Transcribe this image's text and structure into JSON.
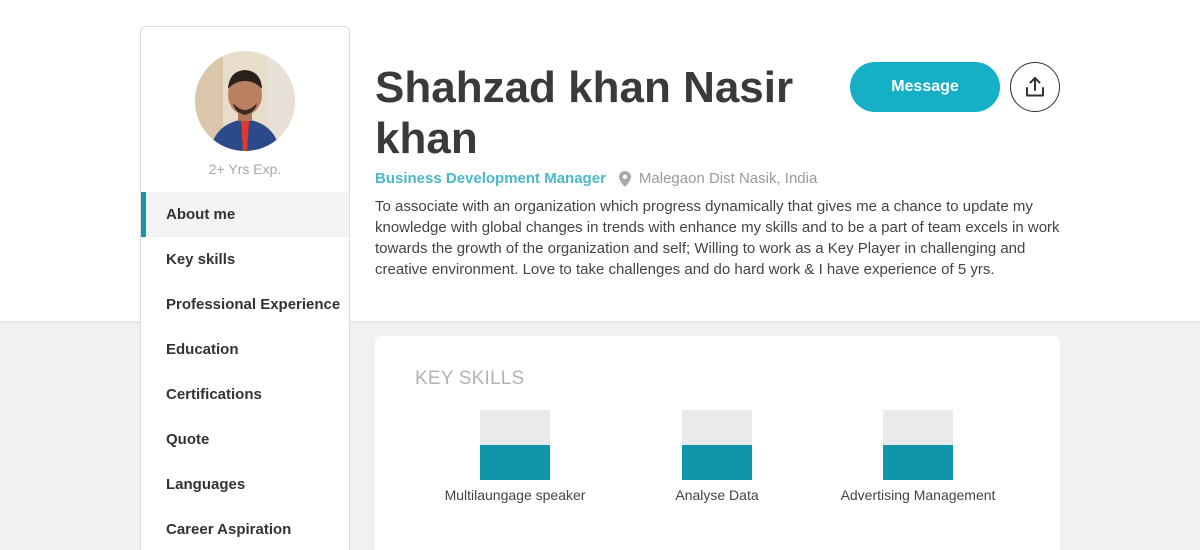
{
  "profile": {
    "name": "Shahzad khan Nasir khan",
    "experience": "2+ Yrs Exp.",
    "role": "Business Development Manager",
    "location": "Malegaon Dist Nasik, India",
    "about": "To associate with an organization which progress dynamically that gives me a chance to update my knowledge with global changes in trends with enhance my skills and to be a part of team excels in work towards the growth of the organization and self; Willing to work as a Key Player in challenging and creative environment. Love to take challenges and do hard work & I have experience of 5 yrs."
  },
  "actions": {
    "message_label": "Message",
    "share_icon": "share-upload-icon"
  },
  "sidebar": {
    "items": [
      {
        "label": "About me",
        "active": true
      },
      {
        "label": "Key skills",
        "active": false
      },
      {
        "label": "Professional Experience",
        "active": false
      },
      {
        "label": "Education",
        "active": false
      },
      {
        "label": "Certifications",
        "active": false
      },
      {
        "label": "Quote",
        "active": false
      },
      {
        "label": "Languages",
        "active": false
      },
      {
        "label": "Career Aspiration",
        "active": false
      }
    ]
  },
  "key_skills": {
    "title": "KEY SKILLS",
    "items": [
      {
        "label": "Multilaungage speaker",
        "level": 0.5
      },
      {
        "label": "Analyse Data",
        "level": 0.5
      },
      {
        "label": "Advertising Management",
        "level": 0.5
      }
    ]
  },
  "colors": {
    "accent": "#16b0c6",
    "skill_bar": "#0f97a9",
    "role_text": "#4bb8c8"
  }
}
